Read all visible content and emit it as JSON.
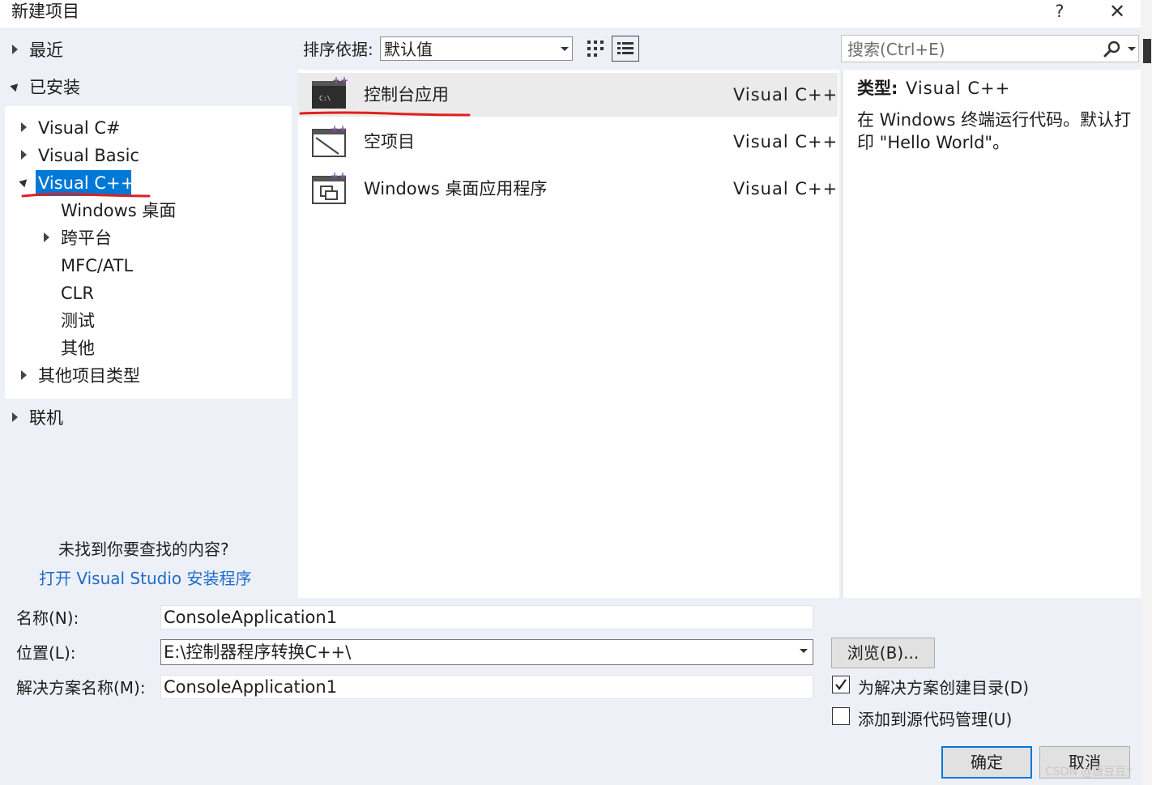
{
  "window": {
    "title": "新建项目",
    "help_label": "?",
    "close_label": "✕"
  },
  "left_pane": {
    "recent_label": "最近",
    "installed_label": "已安装",
    "installed_items": [
      {
        "label": "Visual C#"
      },
      {
        "label": "Visual Basic"
      },
      {
        "label": "Visual C++",
        "selected": true
      },
      {
        "label": "Windows 桌面"
      },
      {
        "label": "跨平台"
      },
      {
        "label": "MFC/ATL"
      },
      {
        "label": "CLR"
      },
      {
        "label": "测试"
      },
      {
        "label": "其他"
      },
      {
        "label": "其他项目类型"
      }
    ],
    "online_label": "联机",
    "not_found_text": "未找到你要查找的内容?",
    "open_installer_link": "打开 Visual Studio 安装程序"
  },
  "toolbar": {
    "sort_label": "排序依据:",
    "sort_value": "默认值",
    "search_placeholder": "搜索(Ctrl+E)"
  },
  "templates": [
    {
      "name": "控制台应用",
      "language": "Visual C++",
      "icon": "console-app-icon",
      "selected": true
    },
    {
      "name": "空项目",
      "language": "Visual C++",
      "icon": "empty-project-icon"
    },
    {
      "name": "Windows 桌面应用程序",
      "language": "Visual C++",
      "icon": "windows-desktop-app-icon"
    }
  ],
  "detail": {
    "type_label": "类型:",
    "type_value": "Visual C++",
    "description": "在 Windows 终端运行代码。默认打印 \"Hello World\"。"
  },
  "form": {
    "name_label": "名称(N):",
    "name_value": "ConsoleApplication1",
    "location_label": "位置(L):",
    "location_value": "E:\\控制器程序转换C++\\",
    "solution_label": "解决方案名称(M):",
    "solution_value": "ConsoleApplication1",
    "browse_label": "浏览(B)...",
    "create_dir_label": "为解决方案创建目录(D)",
    "create_dir_checked": true,
    "add_source_control_label": "添加到源代码管理(U)",
    "add_source_control_checked": false,
    "ok_label": "确定",
    "cancel_label": "取消"
  },
  "watermark": "CSDN @唐豆豆*",
  "colors": {
    "selection": "#0078d7",
    "link": "#1e6cc8",
    "annotation_red": "#e0201b",
    "dialog_bg": "#eef0f8"
  }
}
